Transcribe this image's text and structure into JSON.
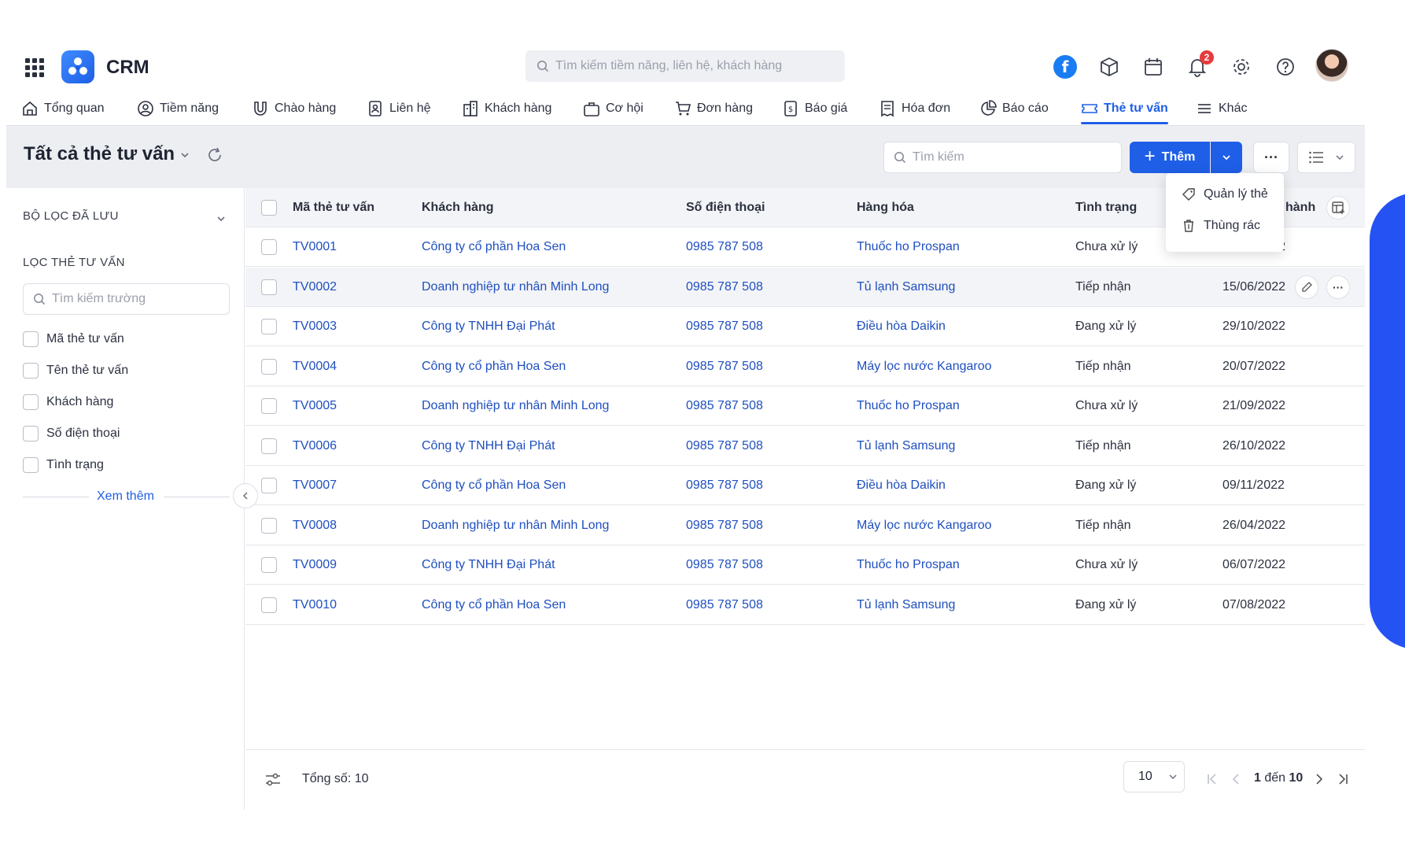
{
  "app": {
    "title": "CRM"
  },
  "header": {
    "search_placeholder": "Tìm kiếm tiềm năng, liên hệ, khách hàng",
    "notification_count": "2",
    "fb_letter": "f"
  },
  "nav": [
    {
      "label": "Tổng quan",
      "icon": "home-icon"
    },
    {
      "label": "Tiềm năng",
      "icon": "user-circle-icon"
    },
    {
      "label": "Chào hàng",
      "icon": "magnet-icon"
    },
    {
      "label": "Liên hệ",
      "icon": "contact-card-icon"
    },
    {
      "label": "Khách hàng",
      "icon": "building-icon"
    },
    {
      "label": "Cơ hội",
      "icon": "briefcase-icon"
    },
    {
      "label": "Đơn hàng",
      "icon": "cart-icon"
    },
    {
      "label": "Báo giá",
      "icon": "quote-doc-icon"
    },
    {
      "label": "Hóa đơn",
      "icon": "invoice-icon"
    },
    {
      "label": "Báo cáo",
      "icon": "pie-chart-icon"
    },
    {
      "label": "Thẻ tư vấn",
      "icon": "ticket-icon",
      "active": true
    },
    {
      "label": "Khác",
      "icon": "menu-icon"
    }
  ],
  "page": {
    "title": "Tất cả thẻ tư vấn",
    "search_placeholder": "Tìm kiếm",
    "add_label": "Thêm",
    "more_label": "···"
  },
  "dropdown": {
    "items": [
      {
        "label": "Quản lý thẻ",
        "icon": "tag-icon"
      },
      {
        "label": "Thùng rác",
        "icon": "trash-icon"
      }
    ]
  },
  "sidebar": {
    "saved_filters_label": "BỘ LỌC ĐÃ LƯU",
    "filter_label": "LỌC THẺ TƯ VẤN",
    "field_search_placeholder": "Tìm kiếm trường",
    "fields": [
      "Mã thẻ tư vấn",
      "Tên thẻ tư vấn",
      "Khách hàng",
      "Số điện thoại",
      "Tình trạng"
    ],
    "see_more": "Xem thêm"
  },
  "table": {
    "columns": [
      "Mã thẻ tư vấn",
      "Khách hàng",
      "Số điện thoại",
      "Hàng hóa",
      "Tình trạng",
      "hành"
    ],
    "rows": [
      {
        "code": "TV0001",
        "customer": "Công ty cổ phần Hoa Sen",
        "phone": "0985 787 508",
        "product": "Thuốc ho Prospan",
        "status": "Chưa xử lý",
        "date": "01/04/2022"
      },
      {
        "code": "TV0002",
        "customer": "Doanh nghiệp tư nhân Minh Long",
        "phone": "0985 787 508",
        "product": "Tủ lạnh Samsung",
        "status": "Tiếp nhận",
        "date": "15/06/2022"
      },
      {
        "code": "TV0003",
        "customer": "Công ty TNHH Đại Phát",
        "phone": "0985 787 508",
        "product": "Điều hòa Daikin",
        "status": "Đang xử lý",
        "date": "29/10/2022"
      },
      {
        "code": "TV0004",
        "customer": "Công ty cổ phần Hoa Sen",
        "phone": "0985 787 508",
        "product": "Máy lọc nước Kangaroo",
        "status": "Tiếp nhận",
        "date": "20/07/2022"
      },
      {
        "code": "TV0005",
        "customer": "Doanh nghiệp tư nhân Minh Long",
        "phone": "0985 787 508",
        "product": "Thuốc ho Prospan",
        "status": "Chưa xử lý",
        "date": "21/09/2022"
      },
      {
        "code": "TV0006",
        "customer": "Công ty TNHH Đại Phát",
        "phone": "0985 787 508",
        "product": "Tủ lạnh Samsung",
        "status": "Tiếp nhận",
        "date": "26/10/2022"
      },
      {
        "code": "TV0007",
        "customer": "Công ty cổ phần Hoa Sen",
        "phone": "0985 787 508",
        "product": "Điều hòa Daikin",
        "status": "Đang xử lý",
        "date": "09/11/2022"
      },
      {
        "code": "TV0008",
        "customer": "Doanh nghiệp tư nhân Minh Long",
        "phone": "0985 787 508",
        "product": "Máy lọc nước Kangaroo",
        "status": "Tiếp nhận",
        "date": "26/04/2022"
      },
      {
        "code": "TV0009",
        "customer": "Công ty TNHH Đại Phát",
        "phone": "0985 787 508",
        "product": "Thuốc ho Prospan",
        "status": "Chưa xử lý",
        "date": "06/07/2022"
      },
      {
        "code": "TV0010",
        "customer": "Công ty cổ phần Hoa Sen",
        "phone": "0985 787 508",
        "product": "Tủ lạnh Samsung",
        "status": "Đang xử lý",
        "date": "07/08/2022"
      }
    ]
  },
  "footer": {
    "total_label": "Tổng số: 10",
    "page_size": "10",
    "range_start": "1",
    "range_word": "đến",
    "range_end": "10"
  },
  "colors": {
    "accent": "#1f5ee6",
    "link": "#1f4fbf",
    "band": "#eceef2",
    "decor": "#2452f3",
    "badge": "#e63b3b"
  }
}
